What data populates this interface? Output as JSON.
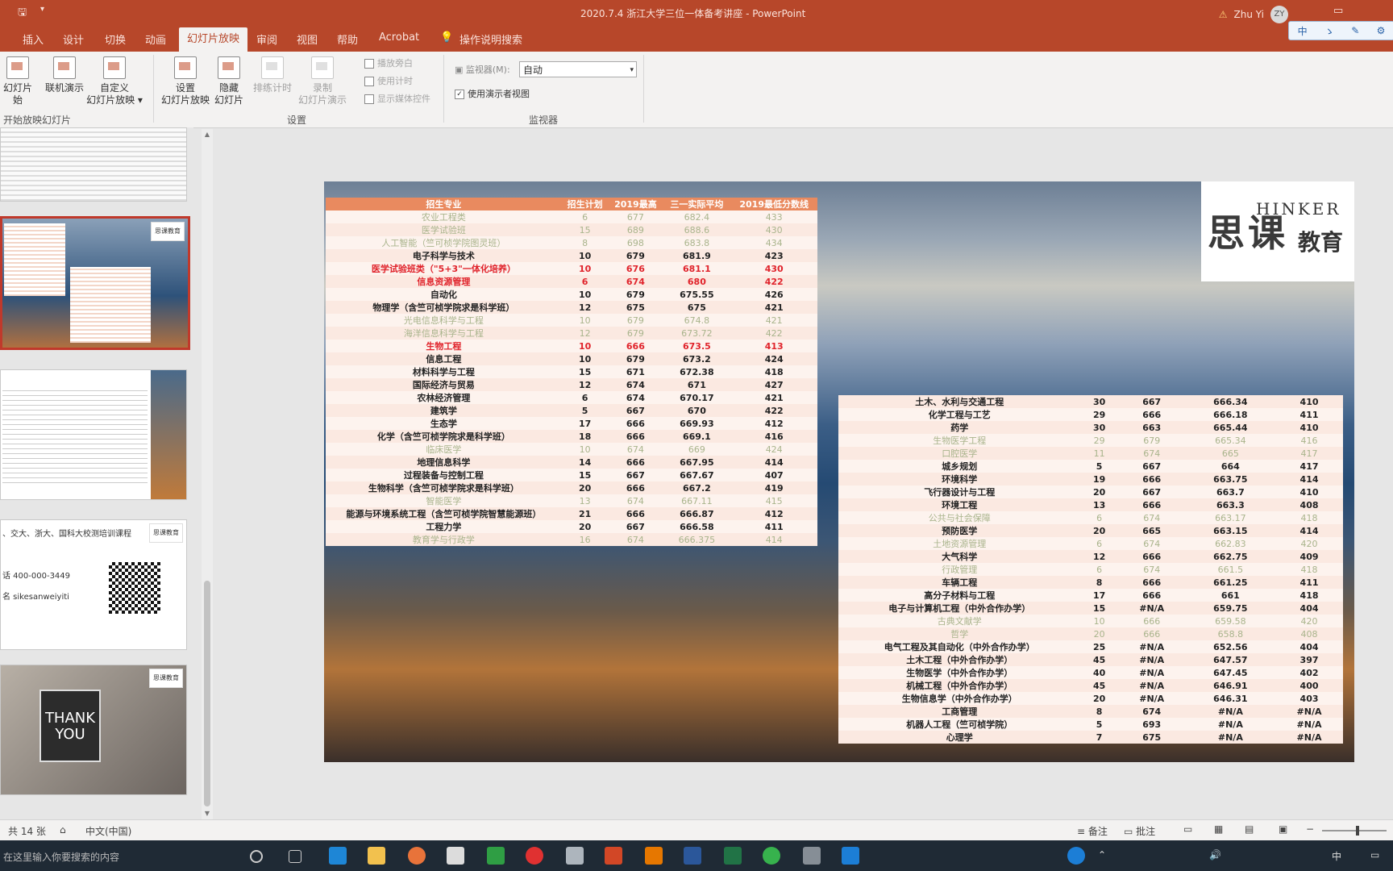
{
  "window": {
    "title": "2020.7.4 浙江大学三位一体备考讲座 - PowerPoint",
    "user": "Zhu Yi",
    "app_icon": "save-icon"
  },
  "ribbon_tabs": [
    "插入",
    "设计",
    "切换",
    "动画",
    "幻灯片放映",
    "审阅",
    "视图",
    "帮助",
    "Acrobat"
  ],
  "active_tab": "幻灯片放映",
  "tell_me": "操作说明搜索",
  "ime": [
    "中",
    "ゝ",
    "✎",
    "⚙"
  ],
  "ribbon": {
    "from_start": "从头开始",
    "from_start_line1": "幻灯片",
    "from_start_line2": "始",
    "online": "联机演示",
    "custom_line1": "自定义",
    "custom_line2": "幻灯片放映",
    "group_start": "开始放映幻灯片",
    "setup_line1": "设置",
    "setup_line2": "幻灯片放映",
    "hide_line1": "隐藏",
    "hide_line2": "幻灯片",
    "rehearse": "排练计时",
    "record_line1": "录制",
    "record_line2": "幻灯片演示",
    "play_narrations": "播放旁白",
    "use_timings": "使用计时",
    "show_media": "显示媒体控件",
    "group_setup": "设置",
    "monitor_label": "监视器(M):",
    "monitor_value": "自动",
    "presenter_view": "使用演示者视图",
    "group_monitors": "监视器"
  },
  "thumbs": {
    "contact_heading": "、交大、浙大、国科大校测培训课程",
    "contact_phone": "话 400-000-3449",
    "contact_wechat": "名 sikesanweiyiti",
    "thank_you_line1": "THANK",
    "thank_you_line2": "YOU",
    "logo_text": "思课教育"
  },
  "logo": {
    "big1": "思",
    "big2": "课",
    "en": "HINKER",
    "cn": "教育"
  },
  "left_table": {
    "headers": [
      "招生专业",
      "招生计划",
      "2019最高",
      "三一实际平均",
      "2019最低分数线"
    ],
    "rows": [
      {
        "style": "faded",
        "c": [
          "农业工程类",
          "6",
          "677",
          "682.4",
          "433"
        ]
      },
      {
        "style": "faded",
        "c": [
          "医学试验班",
          "15",
          "689",
          "688.6",
          "430"
        ]
      },
      {
        "style": "faded",
        "c": [
          "人工智能（竺可桢学院图灵班）",
          "8",
          "698",
          "683.8",
          "434"
        ]
      },
      {
        "style": "",
        "c": [
          "电子科学与技术",
          "10",
          "679",
          "681.9",
          "423"
        ]
      },
      {
        "style": "red",
        "c": [
          "医学试验班类（\"5+3\"一体化培养）",
          "10",
          "676",
          "681.1",
          "430"
        ]
      },
      {
        "style": "red",
        "c": [
          "信息资源管理",
          "6",
          "674",
          "680",
          "422"
        ]
      },
      {
        "style": "",
        "c": [
          "自动化",
          "10",
          "679",
          "675.55",
          "426"
        ]
      },
      {
        "style": "",
        "c": [
          "物理学（含竺可桢学院求是科学班）",
          "12",
          "675",
          "675",
          "421"
        ]
      },
      {
        "style": "faded",
        "c": [
          "光电信息科学与工程",
          "10",
          "679",
          "674.8",
          "421"
        ]
      },
      {
        "style": "faded",
        "c": [
          "海洋信息科学与工程",
          "12",
          "679",
          "673.72",
          "422"
        ]
      },
      {
        "style": "red",
        "c": [
          "生物工程",
          "10",
          "666",
          "673.5",
          "413"
        ]
      },
      {
        "style": "",
        "c": [
          "信息工程",
          "10",
          "679",
          "673.2",
          "424"
        ]
      },
      {
        "style": "",
        "c": [
          "材料科学与工程",
          "15",
          "671",
          "672.38",
          "418"
        ]
      },
      {
        "style": "",
        "c": [
          "国际经济与贸易",
          "12",
          "674",
          "671",
          "427"
        ]
      },
      {
        "style": "",
        "c": [
          "农林经济管理",
          "6",
          "674",
          "670.17",
          "421"
        ]
      },
      {
        "style": "",
        "c": [
          "建筑学",
          "5",
          "667",
          "670",
          "422"
        ]
      },
      {
        "style": "",
        "c": [
          "生态学",
          "17",
          "666",
          "669.93",
          "412"
        ]
      },
      {
        "style": "",
        "c": [
          "化学（含竺可桢学院求是科学班）",
          "18",
          "666",
          "669.1",
          "416"
        ]
      },
      {
        "style": "faded",
        "c": [
          "临床医学",
          "10",
          "674",
          "669",
          "424"
        ]
      },
      {
        "style": "",
        "c": [
          "地理信息科学",
          "14",
          "666",
          "667.95",
          "414"
        ]
      },
      {
        "style": "",
        "c": [
          "过程装备与控制工程",
          "15",
          "667",
          "667.67",
          "407"
        ]
      },
      {
        "style": "",
        "c": [
          "生物科学（含竺可桢学院求是科学班）",
          "20",
          "666",
          "667.2",
          "419"
        ]
      },
      {
        "style": "faded",
        "c": [
          "智能医学",
          "13",
          "674",
          "667.11",
          "415"
        ]
      },
      {
        "style": "",
        "c": [
          "能源与环境系统工程（含竺可桢学院智慧能源班）",
          "21",
          "666",
          "666.87",
          "412"
        ]
      },
      {
        "style": "",
        "c": [
          "工程力学",
          "20",
          "667",
          "666.58",
          "411"
        ]
      },
      {
        "style": "faded",
        "c": [
          "教育学与行政学",
          "16",
          "674",
          "666.375",
          "414"
        ]
      }
    ]
  },
  "right_table": {
    "rows": [
      {
        "style": "",
        "c": [
          "土木、水利与交通工程",
          "30",
          "667",
          "666.34",
          "410"
        ]
      },
      {
        "style": "",
        "c": [
          "化学工程与工艺",
          "29",
          "666",
          "666.18",
          "411"
        ]
      },
      {
        "style": "",
        "c": [
          "药学",
          "30",
          "663",
          "665.44",
          "410"
        ]
      },
      {
        "style": "faded",
        "c": [
          "生物医学工程",
          "29",
          "679",
          "665.34",
          "416"
        ]
      },
      {
        "style": "faded",
        "c": [
          "口腔医学",
          "11",
          "674",
          "665",
          "417"
        ]
      },
      {
        "style": "",
        "c": [
          "城乡规划",
          "5",
          "667",
          "664",
          "417"
        ]
      },
      {
        "style": "",
        "c": [
          "环境科学",
          "19",
          "666",
          "663.75",
          "414"
        ]
      },
      {
        "style": "",
        "c": [
          "飞行器设计与工程",
          "20",
          "667",
          "663.7",
          "410"
        ]
      },
      {
        "style": "",
        "c": [
          "环境工程",
          "13",
          "666",
          "663.3",
          "408"
        ]
      },
      {
        "style": "faded",
        "c": [
          "公共与社会保障",
          "6",
          "674",
          "663.17",
          "418"
        ]
      },
      {
        "style": "",
        "c": [
          "预防医学",
          "20",
          "665",
          "663.15",
          "414"
        ]
      },
      {
        "style": "faded",
        "c": [
          "土地资源管理",
          "6",
          "674",
          "662.83",
          "420"
        ]
      },
      {
        "style": "",
        "c": [
          "大气科学",
          "12",
          "666",
          "662.75",
          "409"
        ]
      },
      {
        "style": "faded",
        "c": [
          "行政管理",
          "6",
          "674",
          "661.5",
          "418"
        ]
      },
      {
        "style": "",
        "c": [
          "车辆工程",
          "8",
          "666",
          "661.25",
          "411"
        ]
      },
      {
        "style": "",
        "c": [
          "高分子材料与工程",
          "17",
          "666",
          "661",
          "418"
        ]
      },
      {
        "style": "",
        "c": [
          "电子与计算机工程（中外合作办学）",
          "15",
          "#N/A",
          "659.75",
          "404"
        ]
      },
      {
        "style": "faded",
        "c": [
          "古典文献学",
          "10",
          "666",
          "659.58",
          "420"
        ]
      },
      {
        "style": "faded",
        "c": [
          "哲学",
          "20",
          "666",
          "658.8",
          "408"
        ]
      },
      {
        "style": "",
        "c": [
          "电气工程及其自动化（中外合作办学）",
          "25",
          "#N/A",
          "652.56",
          "404"
        ]
      },
      {
        "style": "",
        "c": [
          "土木工程（中外合作办学）",
          "45",
          "#N/A",
          "647.57",
          "397"
        ]
      },
      {
        "style": "",
        "c": [
          "生物医学（中外合作办学）",
          "40",
          "#N/A",
          "647.45",
          "402"
        ]
      },
      {
        "style": "",
        "c": [
          "机械工程（中外合作办学）",
          "45",
          "#N/A",
          "646.91",
          "400"
        ]
      },
      {
        "style": "",
        "c": [
          "生物信息学（中外合作办学）",
          "20",
          "#N/A",
          "646.31",
          "403"
        ]
      },
      {
        "style": "",
        "c": [
          "工商管理",
          "8",
          "674",
          "#N/A",
          "#N/A"
        ]
      },
      {
        "style": "",
        "c": [
          "机器人工程（竺可桢学院）",
          "5",
          "693",
          "#N/A",
          "#N/A"
        ]
      },
      {
        "style": "",
        "c": [
          "心理学",
          "7",
          "675",
          "#N/A",
          "#N/A"
        ]
      }
    ]
  },
  "status": {
    "slide_count": "共 14 张",
    "language": "中文(中国)",
    "notes": "备注",
    "comments": "批注"
  },
  "taskbar": {
    "search": "在这里输入你要搜索的内容",
    "ime": "中"
  }
}
